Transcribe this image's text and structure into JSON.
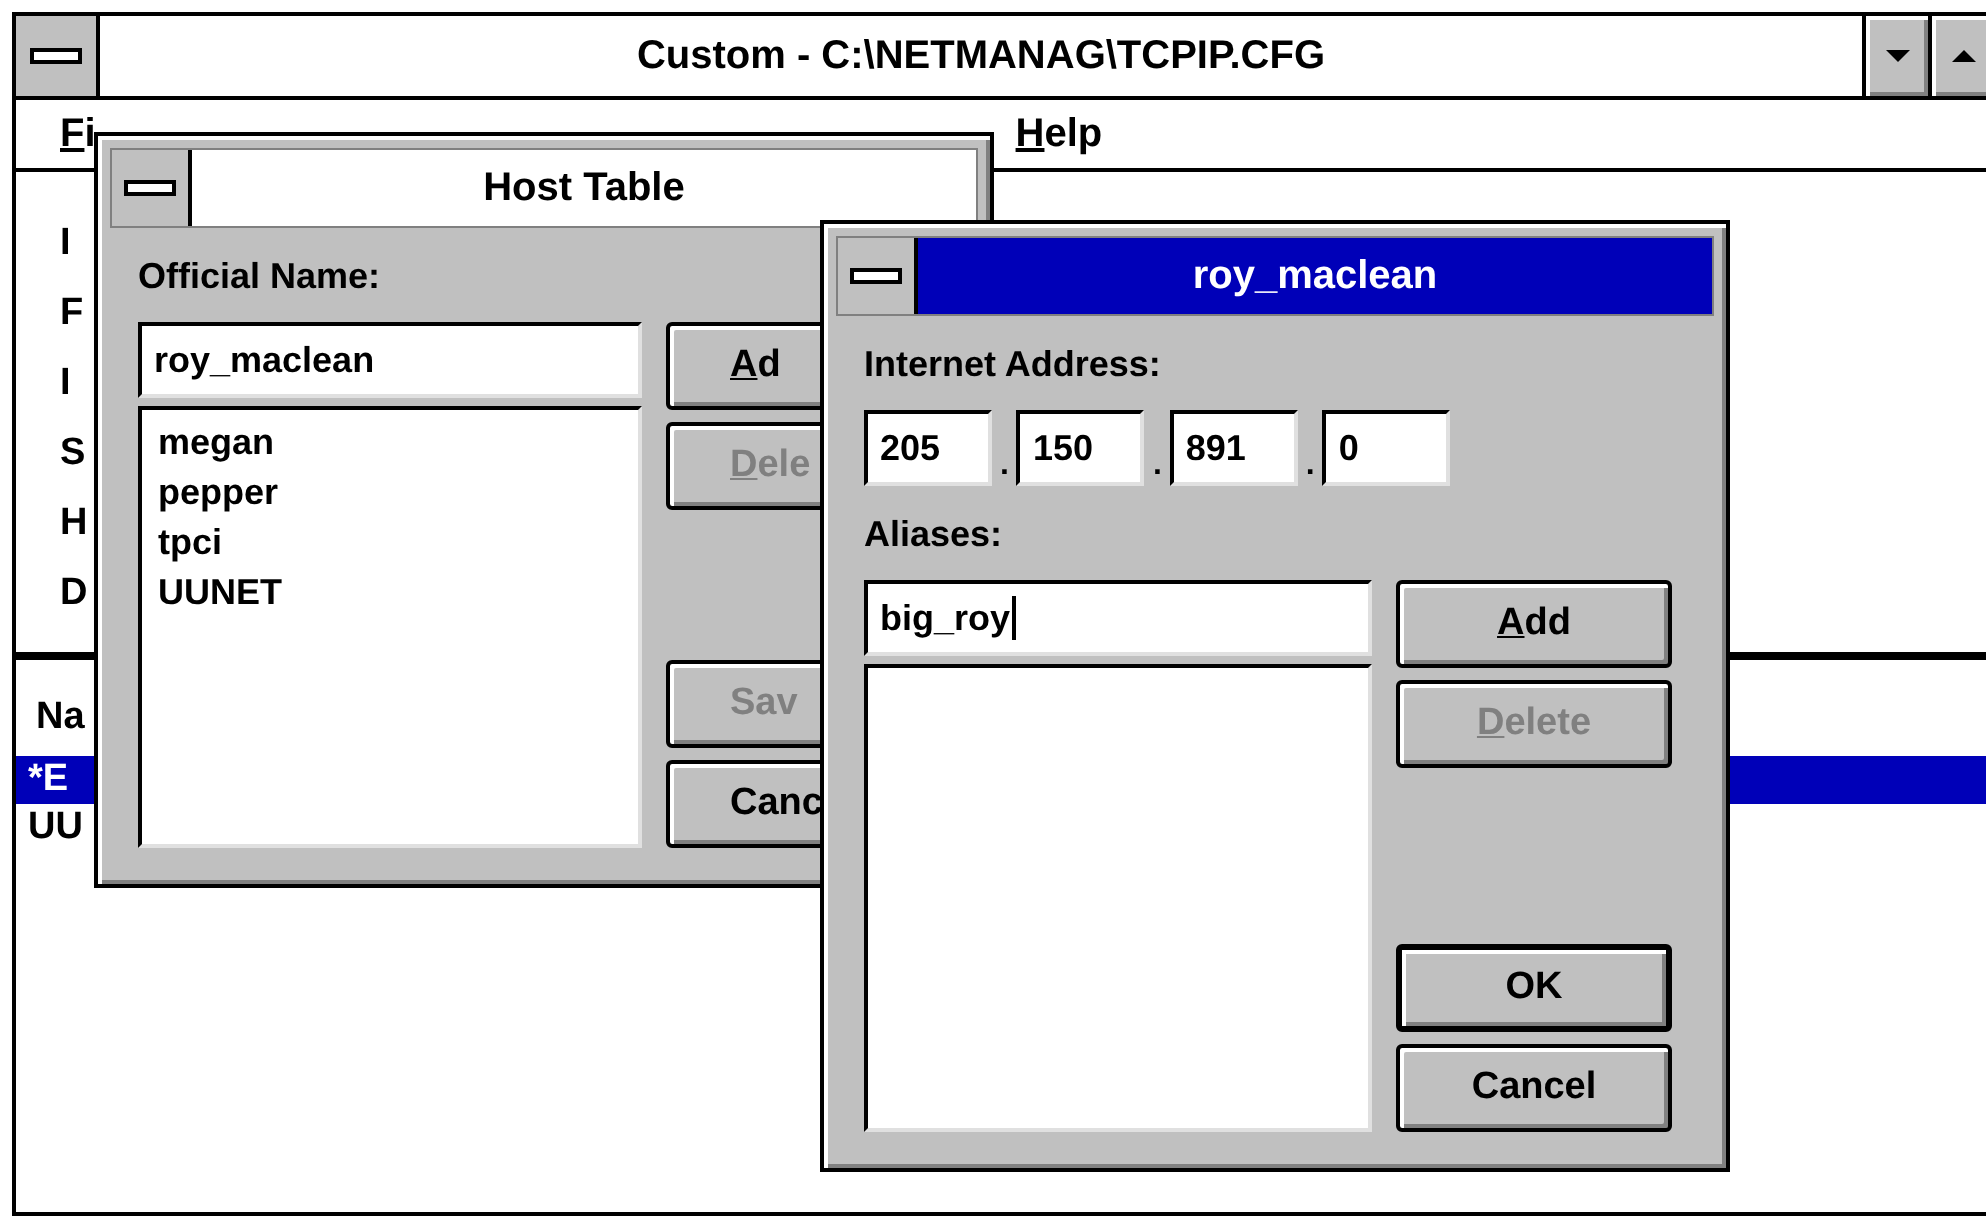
{
  "main_window": {
    "title": "Custom - C:\\NETMANAG\\TCPIP.CFG",
    "menu": [
      {
        "label": "Fi",
        "mnemonic": true
      },
      {
        "label": "Help",
        "mnemonic": true
      }
    ],
    "side_labels": [
      "I",
      "F",
      "I",
      "S",
      "H",
      "D"
    ],
    "list_header": "Na",
    "rows": [
      {
        "text": "*E",
        "selected": true
      },
      {
        "text": "UU",
        "selected": false
      }
    ]
  },
  "host_table": {
    "title": "Host Table",
    "active": false,
    "label": "Official Name:",
    "value": "roy_maclean",
    "items": [
      "megan",
      "pepper",
      "tpci",
      "UUNET"
    ],
    "buttons_top": [
      {
        "label": "Ad",
        "mnemonic": true,
        "disabled": false
      },
      {
        "label": "Dele",
        "mnemonic": true,
        "disabled": true
      }
    ],
    "buttons_bottom": [
      {
        "label": "Sav",
        "mnemonic": false,
        "disabled": true
      },
      {
        "label": "Canc",
        "mnemonic": false,
        "disabled": false
      }
    ]
  },
  "host_dialog": {
    "title": "roy_maclean",
    "active": true,
    "address_label": "Internet Address:",
    "octets": [
      "205",
      "150",
      "891",
      "0"
    ],
    "octet_separator": ".",
    "aliases_label": "Aliases:",
    "alias_value": "big_roy",
    "alias_focused": true,
    "buttons_top": [
      {
        "label": "Add",
        "mnemonic": true,
        "disabled": false,
        "default": false
      },
      {
        "label": "Delete",
        "mnemonic": true,
        "disabled": true,
        "default": false
      }
    ],
    "buttons_bottom": [
      {
        "label": "OK",
        "mnemonic": false,
        "disabled": false,
        "default": true
      },
      {
        "label": "Cancel",
        "mnemonic": false,
        "disabled": false,
        "default": false
      }
    ]
  }
}
